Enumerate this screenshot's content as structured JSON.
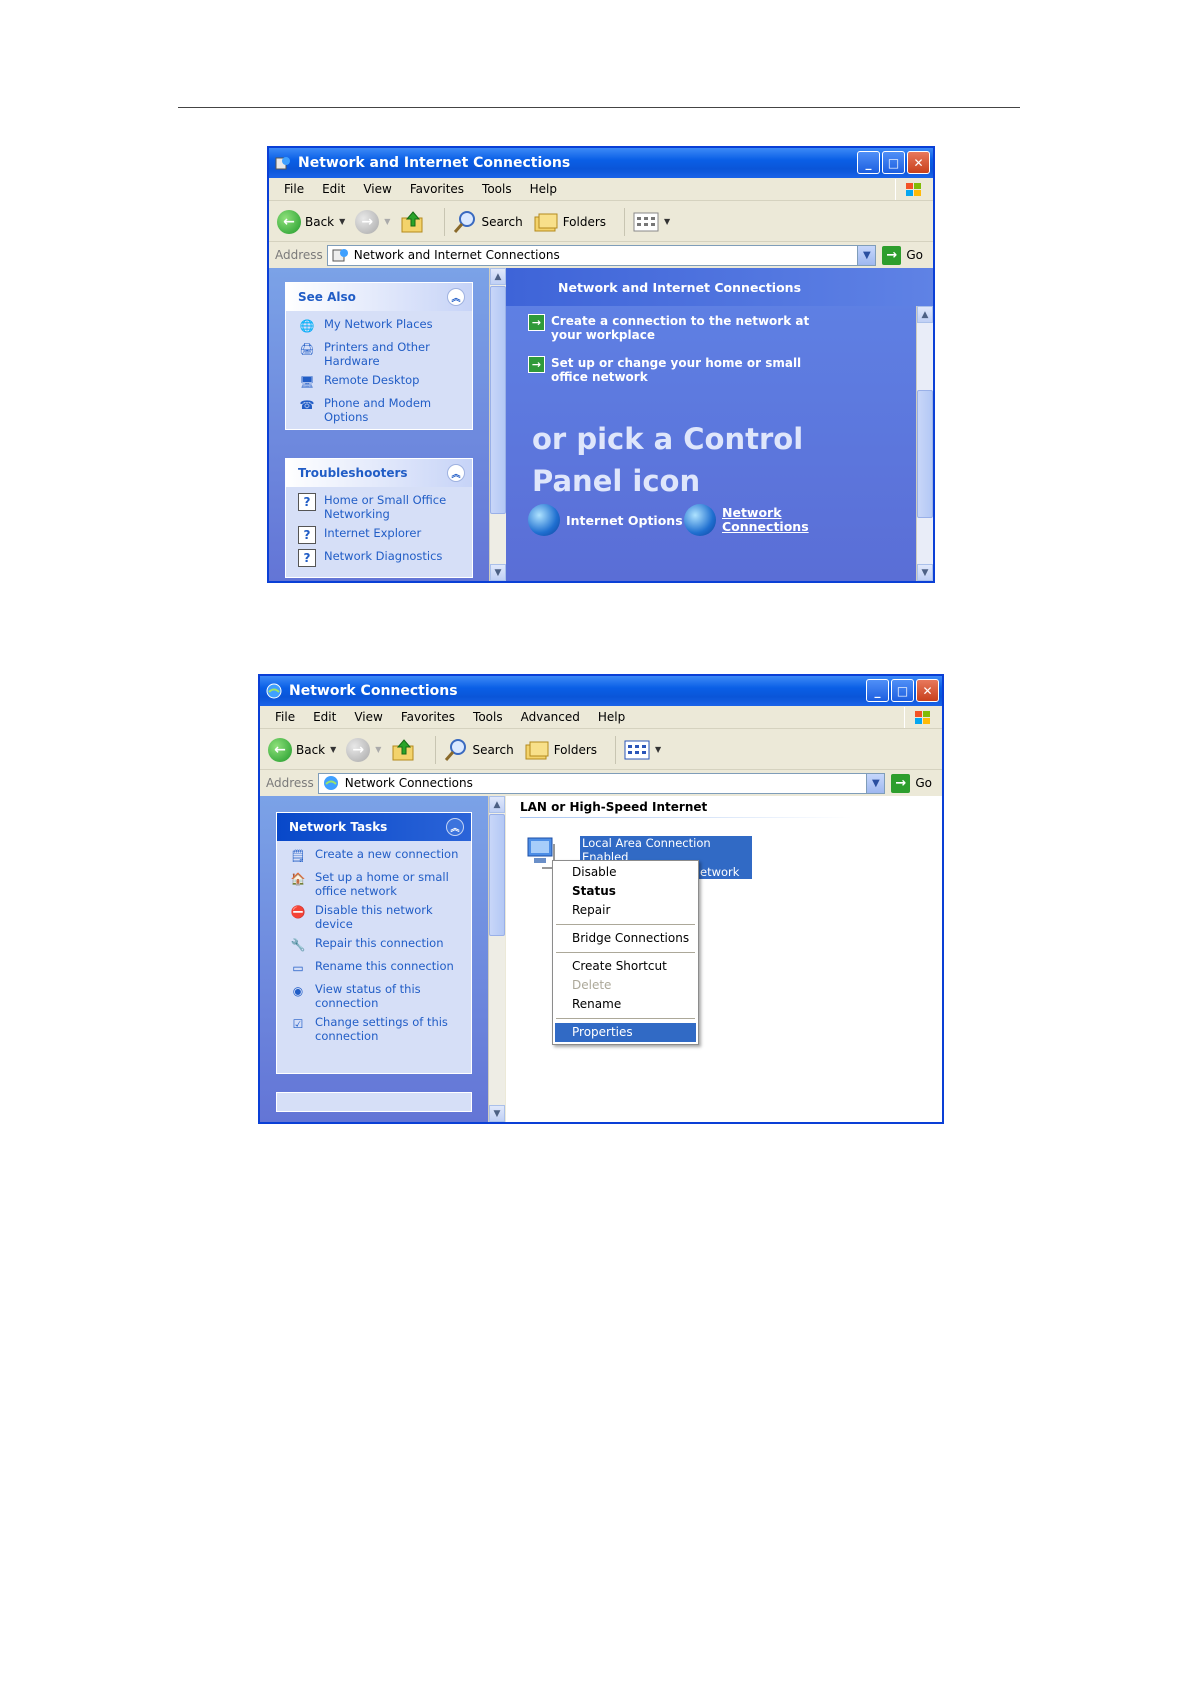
{
  "window1": {
    "title": "Network and Internet Connections",
    "menu": [
      "File",
      "Edit",
      "View",
      "Favorites",
      "Tools",
      "Help"
    ],
    "toolbar": {
      "back": "Back",
      "search": "Search",
      "folders": "Folders"
    },
    "address_label": "Address",
    "address_value": "Network and Internet Connections",
    "go": "Go",
    "see_also": {
      "title": "See Also",
      "items": [
        "My Network Places",
        "Printers and Other Hardware",
        "Remote Desktop",
        "Phone and Modem Options"
      ]
    },
    "troubleshooters": {
      "title": "Troubleshooters",
      "items": [
        "Home or Small Office Networking",
        "Internet Explorer",
        "Network Diagnostics"
      ]
    },
    "content": {
      "heading": "Network and Internet Connections",
      "tasks": [
        "Create a connection to the network at your workplace",
        "Set up or change your home or small office network"
      ],
      "pick_text": "or pick a Control Panel icon",
      "icons": [
        "Internet Options",
        "Network Connections"
      ]
    }
  },
  "window2": {
    "title": "Network Connections",
    "menu": [
      "File",
      "Edit",
      "View",
      "Favorites",
      "Tools",
      "Advanced",
      "Help"
    ],
    "toolbar": {
      "back": "Back",
      "search": "Search",
      "folders": "Folders"
    },
    "address_label": "Address",
    "address_value": "Network Connections",
    "go": "Go",
    "network_tasks": {
      "title": "Network Tasks",
      "items": [
        "Create a new connection",
        "Set up a home or small office network",
        "Disable this network device",
        "Repair this connection",
        "Rename this connection",
        "View status of this connection",
        "Change settings of this connection"
      ]
    },
    "group_heading": "LAN or High-Speed Internet",
    "connection": {
      "name": "Local Area Connection",
      "status": "Enabled",
      "device": "etwork ..."
    },
    "context_menu": {
      "disable": "Disable",
      "status": "Status",
      "repair": "Repair",
      "bridge": "Bridge Connections",
      "shortcut": "Create Shortcut",
      "delete": "Delete",
      "rename": "Rename",
      "properties": "Properties"
    }
  }
}
